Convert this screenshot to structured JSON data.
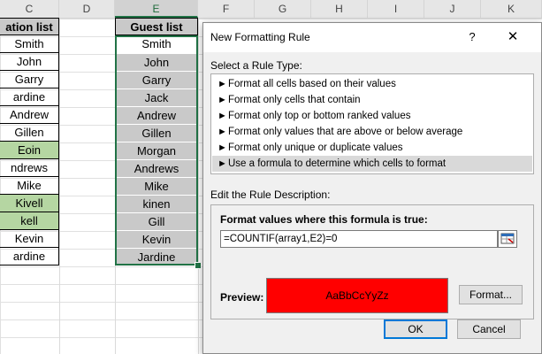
{
  "columns": [
    "C",
    "D",
    "E",
    "F",
    "G",
    "H",
    "I",
    "J",
    "K"
  ],
  "selected_column": "E",
  "invitation_list": {
    "header": "ation list",
    "rows": [
      "Smith",
      "John",
      "Garry",
      "ardine",
      "Andrew",
      "Gillen",
      "Eoin",
      "ndrews",
      "Mike",
      "Kivell",
      "kell",
      "Kevin",
      "ardine"
    ],
    "highlighted_indices": [
      6,
      9,
      10
    ],
    "highlight_color": "#b5d6a2"
  },
  "guest_list": {
    "header": "Guest list",
    "rows": [
      "Smith",
      "John",
      "Garry",
      "Jack",
      "Andrew",
      "Gillen",
      "Morgan",
      "Andrews",
      "Mike",
      "kinen",
      "Gill",
      "Kevin",
      "Jardine"
    ],
    "fill_color": "#c9c9c9"
  },
  "dialog": {
    "title": "New Formatting Rule",
    "help_label": "?",
    "close_label": "✕",
    "select_type_label": "Select a Rule Type:",
    "rule_types": [
      "Format all cells based on their values",
      "Format only cells that contain",
      "Format only top or bottom ranked values",
      "Format only values that are above or below average",
      "Format only unique or duplicate values",
      "Use a formula to determine which cells to format"
    ],
    "selected_rule_index": 5,
    "edit_desc_label": "Edit the Rule Description:",
    "formula_label": "Format values where this formula is true:",
    "formula_value": "=COUNTIF(array1,E2)=0",
    "preview_label": "Preview:",
    "preview_text": "AaBbCcYyZz",
    "preview_fill": "#ff0000",
    "format_button": "Format...",
    "ok_button": "OK",
    "cancel_button": "Cancel"
  }
}
